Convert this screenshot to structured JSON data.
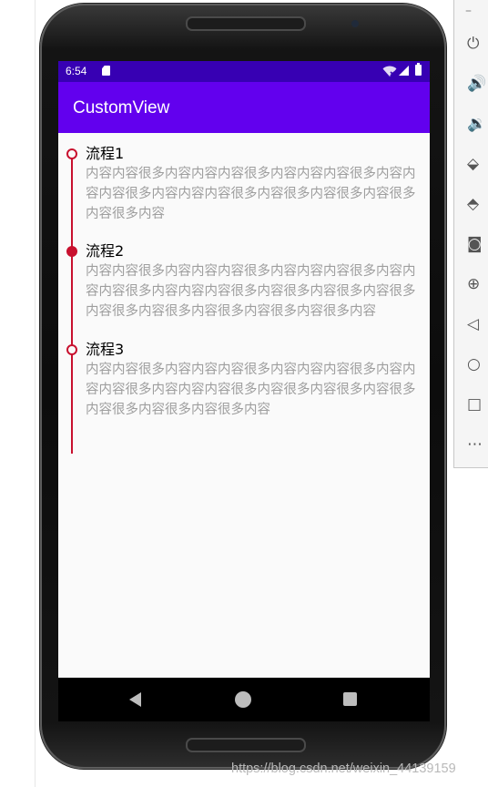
{
  "status_bar": {
    "time": "6:54",
    "icons": [
      "sd-card-icon",
      "wifi-icon",
      "signal-icon",
      "battery-icon"
    ]
  },
  "app_bar": {
    "title": "CustomView"
  },
  "timeline": {
    "color": "#c8102e",
    "steps": [
      {
        "title": "流程1",
        "body": "内容内容很多内容内容内容很多内容内容内容很多内容内容内容很多内容内容内容很多内容很多内容很多内容很多内容很多内容",
        "node": "hollow"
      },
      {
        "title": "流程2",
        "body": "内容内容很多内容内容内容很多内容内容内容很多内容内容内容很多内容内容内容很多内容很多内容很多内容很多内容很多内容很多内容很多内容很多内容很多内容",
        "node": "filled"
      },
      {
        "title": "流程3",
        "body": "内容内容很多内容内容内容很多内容内容内容很多内容内容内容很多内容内容内容很多内容很多内容很多内容很多内容很多内容很多内容很多内容",
        "node": "hollow"
      }
    ]
  },
  "navigation": {
    "icons": [
      "back-icon",
      "home-icon",
      "recents-icon"
    ]
  },
  "emulator_toolbar": {
    "minimize": "–",
    "buttons": [
      {
        "name": "power-icon",
        "glyph": "⏻"
      },
      {
        "name": "volume-up-icon",
        "glyph": "🔊"
      },
      {
        "name": "volume-down-icon",
        "glyph": "🔉"
      },
      {
        "name": "rotate-left-icon",
        "glyph": "⬙"
      },
      {
        "name": "rotate-right-icon",
        "glyph": "⬘"
      },
      {
        "name": "camera-icon",
        "glyph": "◙"
      },
      {
        "name": "zoom-icon",
        "glyph": "⊕"
      },
      {
        "name": "back-icon",
        "glyph": "◁"
      },
      {
        "name": "home-icon",
        "glyph": "○"
      },
      {
        "name": "overview-icon",
        "glyph": "□"
      },
      {
        "name": "more-icon",
        "glyph": "⋯"
      }
    ]
  },
  "watermark": "https://blog.csdn.net/weixin_44139159",
  "colors": {
    "status_bar": "#3700b3",
    "app_bar": "#6200ee",
    "accent": "#c8102e",
    "body_text": "#9e9e9e"
  }
}
